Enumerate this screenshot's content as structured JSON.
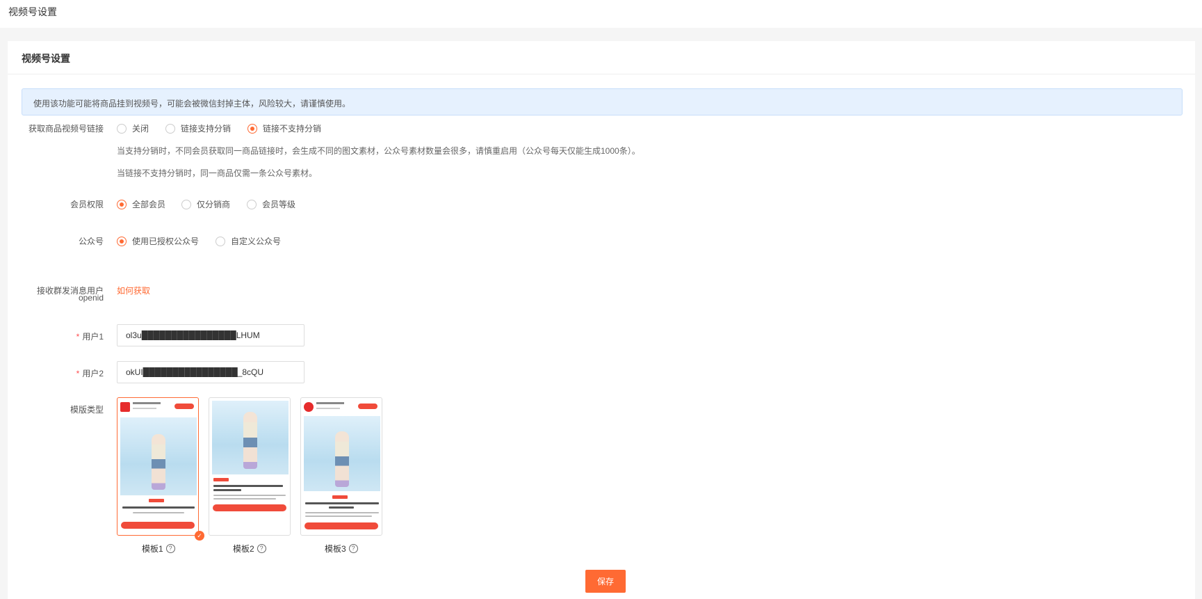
{
  "header": {
    "title": "视频号设置"
  },
  "card": {
    "title": "视频号设置"
  },
  "alert": {
    "text": "使用该功能可能将商品挂到视频号，可能会被微信封掉主体，风险较大，请谨慎使用。"
  },
  "link_setting": {
    "label": "获取商品视频号链接",
    "options": [
      "关闭",
      "链接支持分销",
      "链接不支持分销"
    ],
    "selected": "链接不支持分销",
    "hint1": "当支持分销时，不同会员获取同一商品链接时，会生成不同的图文素材，公众号素材数量会很多，请慎重启用（公众号每天仅能生成1000条）。",
    "hint2": "当链接不支持分销时，同一商品仅需一条公众号素材。"
  },
  "member_permission": {
    "label": "会员权限",
    "options": [
      "全部会员",
      "仅分销商",
      "会员等级"
    ],
    "selected": "全部会员"
  },
  "official_account": {
    "label": "公众号",
    "options": [
      "使用已授权公众号",
      "自定义公众号"
    ],
    "selected": "使用已授权公众号"
  },
  "openid": {
    "label_line1": "接收群发消息用户",
    "label_line2": "openid",
    "link": "如何获取"
  },
  "users": [
    {
      "label": "用户1",
      "value": "ol3u████████████████LHUM"
    },
    {
      "label": "用户2",
      "value": "okUI████████████████_8cQU"
    }
  ],
  "templates": {
    "label": "模版类型",
    "items": [
      "模板1",
      "模板2",
      "模板3"
    ],
    "selected": "模板1"
  },
  "save_label": "保存",
  "colors": {
    "accent": "#ff6a33",
    "alert_bg": "#e6f1fe",
    "required": "#ff4d4f"
  }
}
